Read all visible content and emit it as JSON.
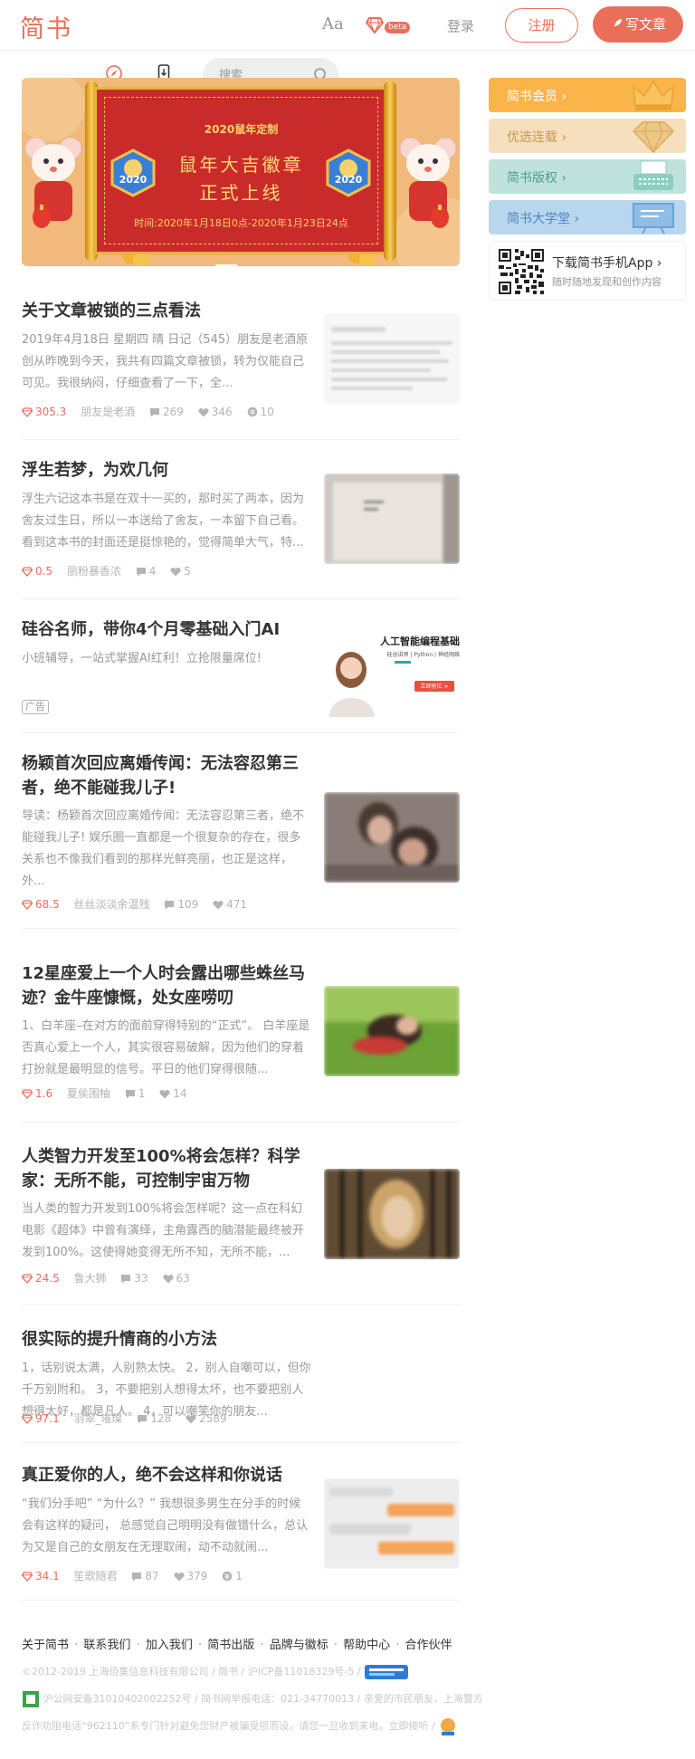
{
  "header": {
    "logo": "简书",
    "font_toggle": "Aa",
    "beta_label": "beta",
    "login": "登录",
    "signup": "注册",
    "write": "写文章"
  },
  "search": {
    "placeholder": "搜索"
  },
  "banner": {
    "subtitle": "2020鼠年定制",
    "title_line1": "鼠年大吉徽章",
    "title_line2": "正式上线",
    "badge_year": "2020",
    "date_range": "时间:2020年1月18日0点-2020年1月23日24点"
  },
  "sidebar": {
    "items": [
      {
        "label": "简书会员 ›",
        "color": "#f9b54a"
      },
      {
        "label": "优选连载 ›",
        "color": "#f5dfbd"
      },
      {
        "label": "简书版权 ›",
        "color": "#bfe3dc"
      },
      {
        "label": "简书大学堂 ›",
        "color": "#b9d6ef"
      }
    ],
    "app": {
      "title": "下载简书手机App ›",
      "subtitle": "随时随地发现和创作内容"
    }
  },
  "articles": [
    {
      "title": "关于文章被锁的三点看法",
      "abstract": "2019年4月18日 星期四 晴 日记（545）朋友是老酒原创从昨晚到今天，我共有四篇文章被锁，转为仅能自己可见。我很纳闷，仔细查看了一下，全...",
      "diamond": "305.3",
      "author": "朋友是老酒",
      "comments": "269",
      "likes": "346",
      "rewards": "10"
    },
    {
      "title": "浮生若梦，为欢几何",
      "abstract": "浮生六记这本书是在双十一买的，那时买了两本，因为舍友过生日，所以一本送给了舍友，一本留下自己看。看到这本书的封面还是挺惊艳的，觉得简单大气，特...",
      "diamond": "0.5",
      "author": "丽粉暴香浓",
      "comments": "4",
      "likes": "5"
    },
    {
      "title": "硅谷名师，带你4个月零基础入门AI",
      "abstract": "小班辅导，一站式掌握AI红利！立抢限量席位!",
      "ad_tag": "广告",
      "ad_image_title": "人工智能编程基础",
      "ad_image_sub": "硅谷讲师 | Python | 神经网络",
      "ad_image_btn": "立即抢位 >"
    },
    {
      "title": "杨颖首次回应离婚传闻：无法容忍第三者，绝不能碰我儿子!",
      "abstract": "导读：杨颖首次回应离婚传闻：无法容忍第三者，绝不能碰我儿子! 娱乐圈一直都是一个很复杂的存在，很多关系也不像我们看到的那样光鲜亮丽，也正是这样，外...",
      "diamond": "68.5",
      "author": "丝丝淡淡余温残",
      "comments": "109",
      "likes": "471"
    },
    {
      "title": "12星座爱上一个人时会露出哪些蛛丝马迹？金牛座慷慨，处女座唠叨",
      "abstract": "1、白羊座–在对方的面前穿得特别的“正式”。 白羊座是否真心爱上一个人，其实很容易破解，因为他们的穿着打扮就是最明显的信号。平日的他们穿得很随...",
      "diamond": "1.6",
      "author": "夏侯围柚",
      "comments": "1",
      "likes": "14"
    },
    {
      "title": "人类智力开发至100%将会怎样？科学家：无所不能，可控制宇宙万物",
      "abstract": "当人类的智力开发到100%将会怎样呢？这一点在科幻电影《超体》中曾有演绎，主角露西的脑潜能最终被开发到100%。这使得她变得无所不知，无所不能，...",
      "diamond": "24.5",
      "author": "鲁大狮",
      "comments": "33",
      "likes": "63"
    },
    {
      "title": "很实际的提升情商的小方法",
      "abstract": "1，话别说太满，人别熟太快。 2，别人自嘲可以，但你千万别附和。 3，不要把别人想得太坏，也不要把别人想得太好，都是凡人。 4，可以嘲笑你的朋友...",
      "diamond": "97.1",
      "author": "羽翠_璀璨",
      "comments": "128",
      "likes": "2589"
    },
    {
      "title": "真正爱你的人，绝不会这样和你说话",
      "abstract": "“我们分手吧” “为什么？” 我想很多男生在分手的时候会有这样的疑问， 总感觉自己明明没有做错什么，总认为又是自己的女朋友在无理取闹，动不动就闹...",
      "diamond": "34.1",
      "author": "笙歌随君",
      "comments": "87",
      "likes": "379",
      "rewards": "1"
    }
  ],
  "footer": {
    "links": [
      "关于简书",
      "联系我们",
      "加入我们",
      "简书出版",
      "品牌与徽标",
      "帮助中心",
      "合作伙伴"
    ],
    "line1": "©2012-2019 上海佰集信息科技有限公司 / 简书 / 沪ICP备11018329号-5 /",
    "line2": "沪公网安备31010402002252号 /        简书网举报电话：021-34770013 /        亲爱的市民朋友，上海警方反诈劝阻电话“962110”系专门针对避免您财产被骗受损而设，请您一旦收到来电，立即接听 /"
  }
}
